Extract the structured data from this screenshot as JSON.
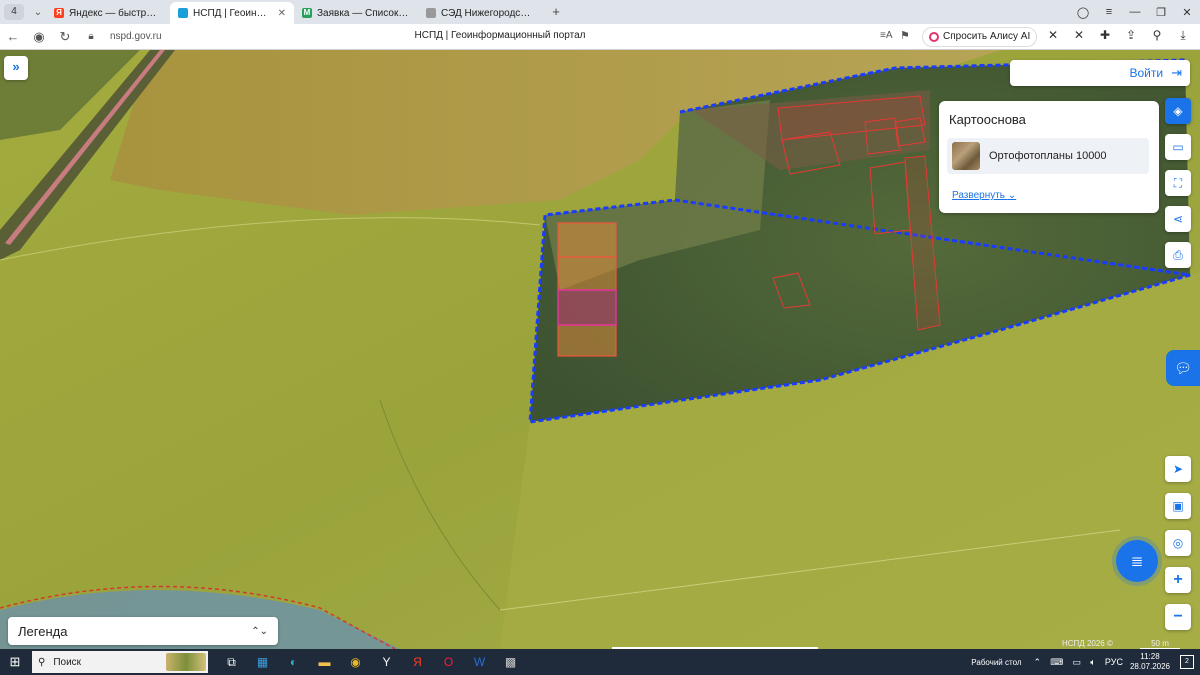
{
  "browser": {
    "tab_count": "4",
    "tabs": [
      {
        "label": "Яндекс — быстрый поиск",
        "icon": "yandex-icon",
        "color": "#fc3f1d",
        "active": false
      },
      {
        "label": "НСПД | Геоинформационный портал",
        "icon": "nspd-icon",
        "color": "#1a9fd9",
        "active": true
      },
      {
        "label": "Заявка — Список заявок",
        "icon": "m-icon",
        "color": "#26a05a",
        "active": false
      },
      {
        "label": "СЭД Нижегородская область",
        "icon": "sed-icon",
        "color": "#999999",
        "active": false
      }
    ],
    "url": "nspd.gov.ru",
    "page_title": "НСПД | Геоинформационный портал",
    "alice_button": "Спросить Алису AI"
  },
  "map": {
    "login_label": "Войти",
    "layer_panel": {
      "title": "Картооснова",
      "layer_name": "Ортофотопланы 10000",
      "expand_label": "Развернуть"
    },
    "legend_label": "Легенда",
    "attribution": "НСПД 2026 ©",
    "scale_label": "50 m",
    "colors": {
      "boundary": "#1a3cff",
      "parcel": "#e53935",
      "accent": "#1a73e8"
    }
  },
  "taskbar": {
    "search_label": "Поиск",
    "desktop_label": "Рабочий стол",
    "language": "РУС",
    "time": "11:28",
    "date": "28.07.2026",
    "notifications": "2"
  }
}
